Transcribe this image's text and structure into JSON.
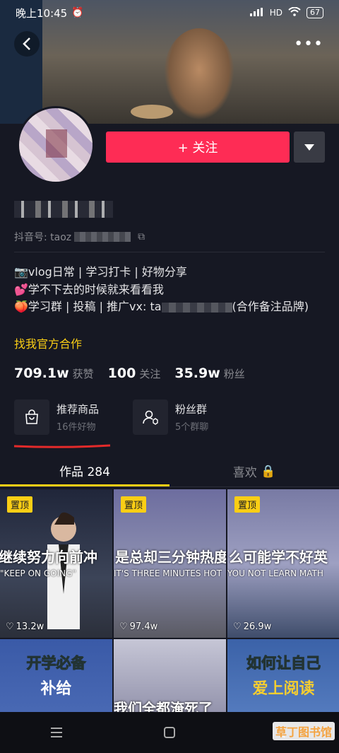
{
  "status_bar": {
    "time": "晚上10:45",
    "network": "HD",
    "battery": "67"
  },
  "profile": {
    "follow_label": "+ 关注",
    "douyin_id_prefix": "抖音号: taoz",
    "bio_lines": [
      "📷vlog日常 | 学习打卡 | 好物分享",
      "💕学不下去的时候就来看看我",
      "🍑学习群 | 投稿 | 推广vx: ta"
    ],
    "bio_tail": "(合作备注品牌)",
    "official_link": "找我官方合作"
  },
  "stats": [
    {
      "num": "709.1w",
      "label": "获赞"
    },
    {
      "num": "100",
      "label": "关注"
    },
    {
      "num": "35.9w",
      "label": "粉丝"
    }
  ],
  "features": [
    {
      "title": "推荐商品",
      "sub": "16件好物"
    },
    {
      "title": "粉丝群",
      "sub": "5个群聊"
    }
  ],
  "tabs": {
    "works": "作品 284",
    "likes": "喜欢"
  },
  "videos": [
    {
      "pin": "置顶",
      "title": "继续努力向前冲",
      "sub": "\"KEEP ON GOING\"",
      "likes": "13.2w"
    },
    {
      "pin": "置顶",
      "title": "是总却三分钟热度",
      "sub": "IT'S THREE MINUTES HOT",
      "likes": "97.4w"
    },
    {
      "pin": "置顶",
      "title": "么可能学不好英",
      "sub": "YOU NOT LEARN MATH",
      "likes": "26.9w"
    },
    {
      "title1": "开学必备",
      "title2": "补给"
    },
    {
      "title": "我们全都淹死了"
    },
    {
      "title1": "如何让自己",
      "title2": "爱上阅读"
    }
  ],
  "watermark": "草丁图书馆"
}
